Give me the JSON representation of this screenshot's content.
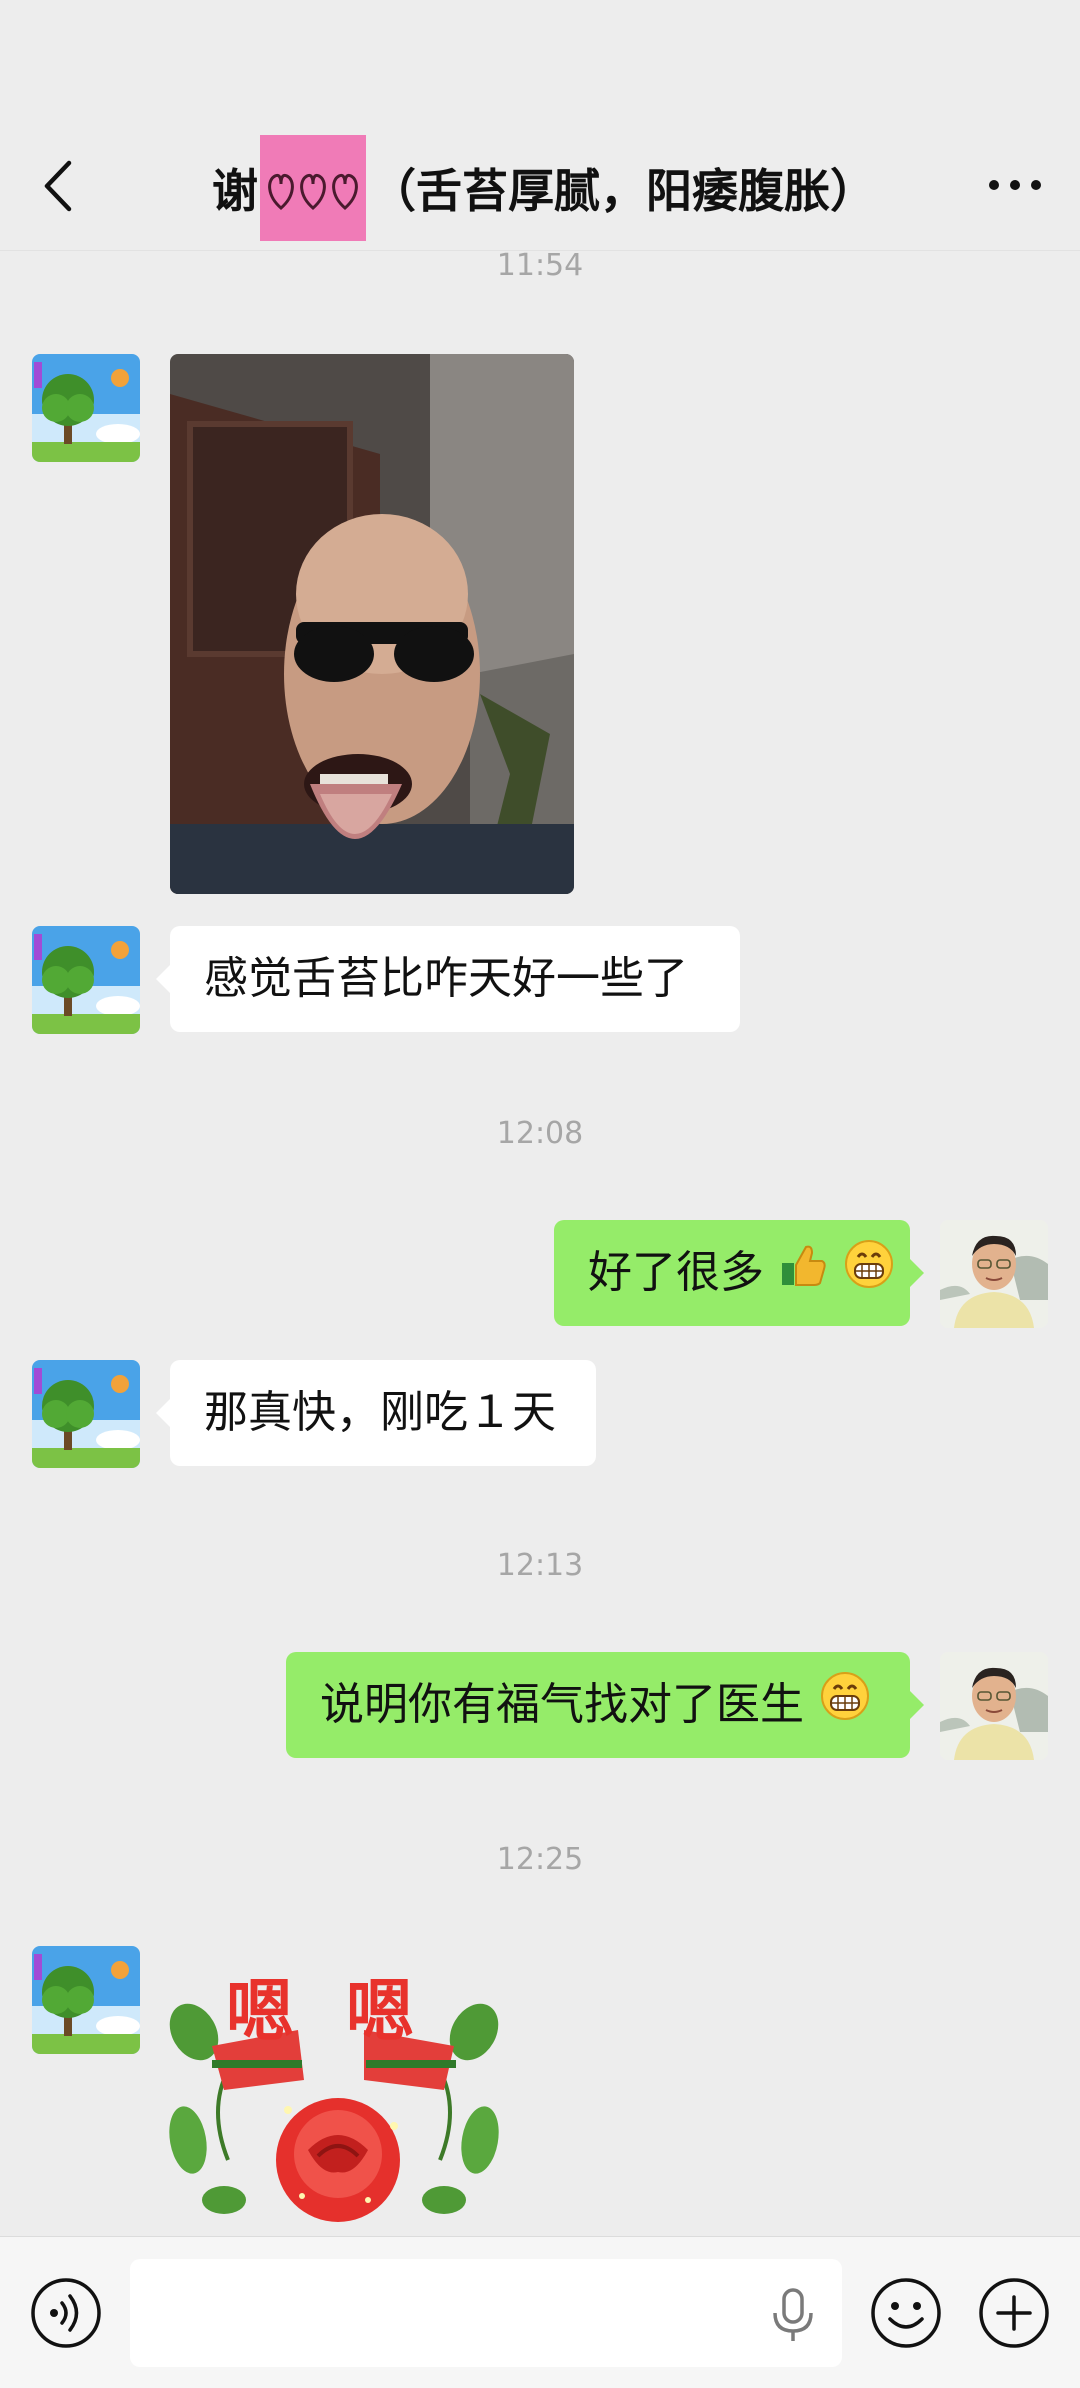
{
  "header": {
    "title_prefix": "谢",
    "title_suffix": "（舌苔厚腻，阳痿腹胀）",
    "back_icon": "chevron-left-icon",
    "more_icon": "more-dots-icon"
  },
  "messages": {
    "ts1": "11:54",
    "photo_icon": "tongue-photo",
    "m2_text": "感觉舌苔比咋天好一些了",
    "ts2": "12:08",
    "m3_text": "好了很多",
    "ts3": "",
    "m4_text": "那真快，刚吃１天",
    "ts4": "12:13",
    "m5_text": "说明你有福气找对了医生",
    "ts5": "12:25",
    "sticker_text_1": "嗯",
    "sticker_text_2": "嗯"
  },
  "timestamps": {
    "ts_1154": "11:54",
    "ts_1208": "12:08",
    "ts_1213": "12:13",
    "ts_1225": "12:25"
  },
  "input_bar": {
    "value": "",
    "placeholder": ""
  },
  "colors": {
    "background": "#ededed",
    "bubble_self": "#95ec69",
    "bubble_other": "#ffffff",
    "title_sticker": "#f07bb7",
    "timestamp_text": "#a6a6a6"
  }
}
